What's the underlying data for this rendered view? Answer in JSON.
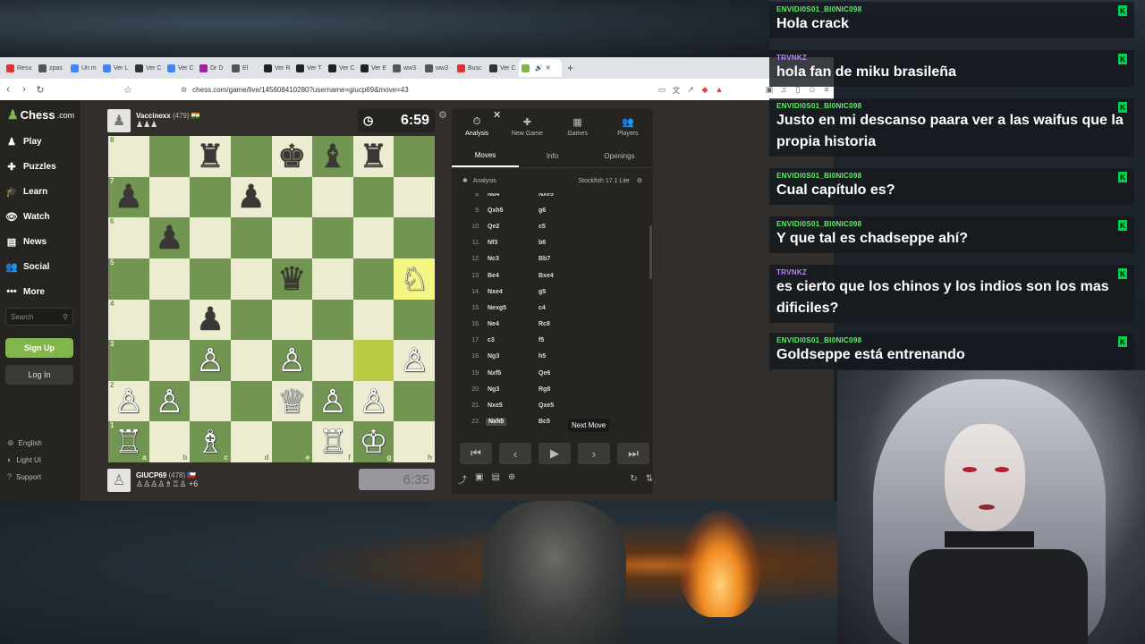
{
  "browser": {
    "tabs": [
      {
        "label": "Resu",
        "color": "#d33"
      },
      {
        "label": "zpas",
        "color": "#555"
      },
      {
        "label": "Un m",
        "color": "#4285f4"
      },
      {
        "label": "Ver L",
        "color": "#4285f4"
      },
      {
        "label": "Ver C",
        "color": "#333"
      },
      {
        "label": "Ver C",
        "color": "#4285f4"
      },
      {
        "label": "Dr D",
        "color": "#a020a0"
      },
      {
        "label": "El",
        "color": "#555"
      },
      {
        "label": "Ver R",
        "color": "#222"
      },
      {
        "label": "Ver T",
        "color": "#222"
      },
      {
        "label": "Ver C",
        "color": "#222"
      },
      {
        "label": "Ver E",
        "color": "#222"
      },
      {
        "label": "ww3",
        "color": "#555"
      },
      {
        "label": "ww3",
        "color": "#555"
      },
      {
        "label": "Busc",
        "color": "#d33"
      },
      {
        "label": "Ver C",
        "color": "#333"
      },
      {
        "label": "",
        "color": "#81b64c"
      }
    ],
    "url": "chess.com/game/live/145608410280?username=giucp69&move=43"
  },
  "sidebar": {
    "logo": "Chess",
    "logo_suffix": ".com",
    "items": [
      {
        "label": "Play",
        "icon": "♟"
      },
      {
        "label": "Puzzles",
        "icon": "✚"
      },
      {
        "label": "Learn",
        "icon": "🎓"
      },
      {
        "label": "Watch",
        "icon": "👁"
      },
      {
        "label": "News",
        "icon": "▤"
      },
      {
        "label": "Social",
        "icon": "👥"
      },
      {
        "label": "More",
        "icon": "•••"
      }
    ],
    "search_placeholder": "Search",
    "signup": "Sign Up",
    "login": "Log In",
    "footer": [
      {
        "label": "English",
        "icon": "⊕"
      },
      {
        "label": "Light UI",
        "icon": "◐"
      },
      {
        "label": "Support",
        "icon": "?"
      }
    ]
  },
  "game": {
    "top_player": {
      "name": "Vaccinexx",
      "rating": "(479)",
      "flag": "🇮🇳",
      "captured": "♟♟♟"
    },
    "bottom_player": {
      "name": "GIUCP69",
      "rating": "(478)",
      "flag": "🇨🇱",
      "captured": "♙♙♙♙♗♖♙",
      "advantage": "+6"
    },
    "top_clock": "6:59",
    "bottom_clock": "6:35",
    "board": [
      [
        "",
        "",
        "♜",
        "",
        "♚",
        "♝",
        "♜",
        ""
      ],
      [
        "♟",
        "",
        "",
        "♟",
        "",
        "",
        "",
        ""
      ],
      [
        "",
        "♟",
        "",
        "",
        "",
        "",
        "",
        ""
      ],
      [
        "",
        "",
        "",
        "",
        "♛",
        "",
        "",
        "♘"
      ],
      [
        "",
        "",
        "♟",
        "",
        "",
        "",
        "",
        ""
      ],
      [
        "",
        "",
        "♙",
        "",
        "♙",
        "",
        "",
        "♙"
      ],
      [
        "♙",
        "♙",
        "",
        "",
        "♕",
        "♙",
        "♙",
        ""
      ],
      [
        "♖",
        "",
        "♗",
        "",
        "",
        "♖",
        "♔",
        ""
      ]
    ],
    "highlight": [
      [
        3,
        7
      ],
      [
        5,
        6
      ]
    ],
    "ranks": [
      "8",
      "7",
      "6",
      "5",
      "4",
      "3",
      "2",
      "1"
    ],
    "files": [
      "a",
      "b",
      "c",
      "d",
      "e",
      "f",
      "g",
      "h"
    ]
  },
  "panel": {
    "tabs": [
      {
        "label": "Analysis",
        "icon": "⏱"
      },
      {
        "label": "New Game",
        "icon": "✚"
      },
      {
        "label": "Games",
        "icon": "▦"
      },
      {
        "label": "Players",
        "icon": "👥"
      }
    ],
    "subtabs": [
      "Moves",
      "Info",
      "Openings"
    ],
    "analysis_label": "Analysis",
    "engine": "Stockfish 17.1 Lite",
    "moves": [
      {
        "n": "8.",
        "w": "Nd4",
        "b": "Nxe5"
      },
      {
        "n": "9.",
        "w": "Qxh5",
        "b": "g6"
      },
      {
        "n": "10.",
        "w": "Qe2",
        "b": "c5"
      },
      {
        "n": "11.",
        "w": "Nf3",
        "b": "b6"
      },
      {
        "n": "12.",
        "w": "Nc3",
        "b": "Bb7"
      },
      {
        "n": "13.",
        "w": "Be4",
        "b": "Bxe4"
      },
      {
        "n": "14.",
        "w": "Nxe4",
        "b": "g5"
      },
      {
        "n": "15.",
        "w": "Nexg5",
        "b": "c4"
      },
      {
        "n": "16.",
        "w": "Ne4",
        "b": "Rc8"
      },
      {
        "n": "17.",
        "w": "c3",
        "b": "f5"
      },
      {
        "n": "18.",
        "w": "Ng3",
        "b": "h5"
      },
      {
        "n": "19.",
        "w": "Nxf5",
        "b": "Qe6"
      },
      {
        "n": "20.",
        "w": "Ng3",
        "b": "Rg8"
      },
      {
        "n": "21.",
        "w": "Nxe5",
        "b": "Qxe5"
      },
      {
        "n": "22.",
        "w": "Nxh5",
        "b": "Bc5"
      }
    ],
    "tooltip": "Next Move"
  },
  "chat": [
    {
      "user": "ENVIDI0S01_BI0NIC098",
      "color": "#5cf26a",
      "text": "Hola crack",
      "badge": "K"
    },
    {
      "user": "TRVNKZ",
      "color": "#c080ff",
      "text": "hola fan de miku brasileña",
      "badge": "K"
    },
    {
      "user": "ENVIDI0S01_BI0NIC098",
      "color": "#5cf26a",
      "text": "Justo en mi descanso paara ver a las waifus que la propia historia",
      "badge": "K"
    },
    {
      "user": "ENVIDI0S01_BI0NIC098",
      "color": "#5cf26a",
      "text": "Cual capítulo es?",
      "badge": "K"
    },
    {
      "user": "ENVIDI0S01_BI0NIC098",
      "color": "#5cf26a",
      "text": "Y que tal es chadseppe ahí?",
      "badge": "K"
    },
    {
      "user": "TRVNKZ",
      "color": "#c080ff",
      "text": "es cierto que los chinos y los indios son los mas dificiles?",
      "badge": "K"
    },
    {
      "user": "ENVIDI0S01_BI0NIC098",
      "color": "#5cf26a",
      "text": "Goldseppe está entrenando",
      "badge": "K"
    }
  ]
}
